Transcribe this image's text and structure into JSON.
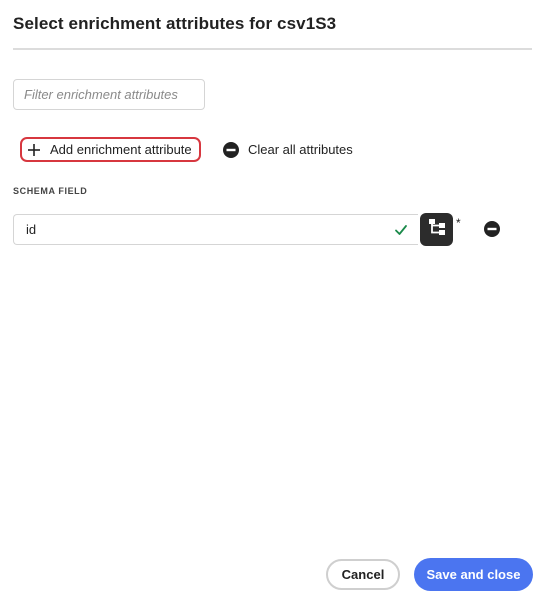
{
  "dialog": {
    "title": "Select enrichment attributes for csv1S3"
  },
  "filter": {
    "placeholder": "Filter enrichment attributes",
    "value": ""
  },
  "actions": {
    "add_label": "Add enrichment attribute",
    "add_icon": "plus-icon",
    "clear_label": "Clear all attributes",
    "clear_icon": "remove-circle-icon",
    "add_highlight_color": "#d7373f"
  },
  "schema": {
    "section_label": "SCHEMA FIELD",
    "fields": [
      {
        "value": "id",
        "status_icon": "checkmark-icon",
        "status_color": "#1a8a4a",
        "schema_icon": "schema-tree-icon",
        "required_mark": "*",
        "remove_icon": "remove-circle-icon"
      }
    ]
  },
  "footer": {
    "cancel_label": "Cancel",
    "save_label": "Save and close",
    "save_color": "#4b75f0"
  }
}
